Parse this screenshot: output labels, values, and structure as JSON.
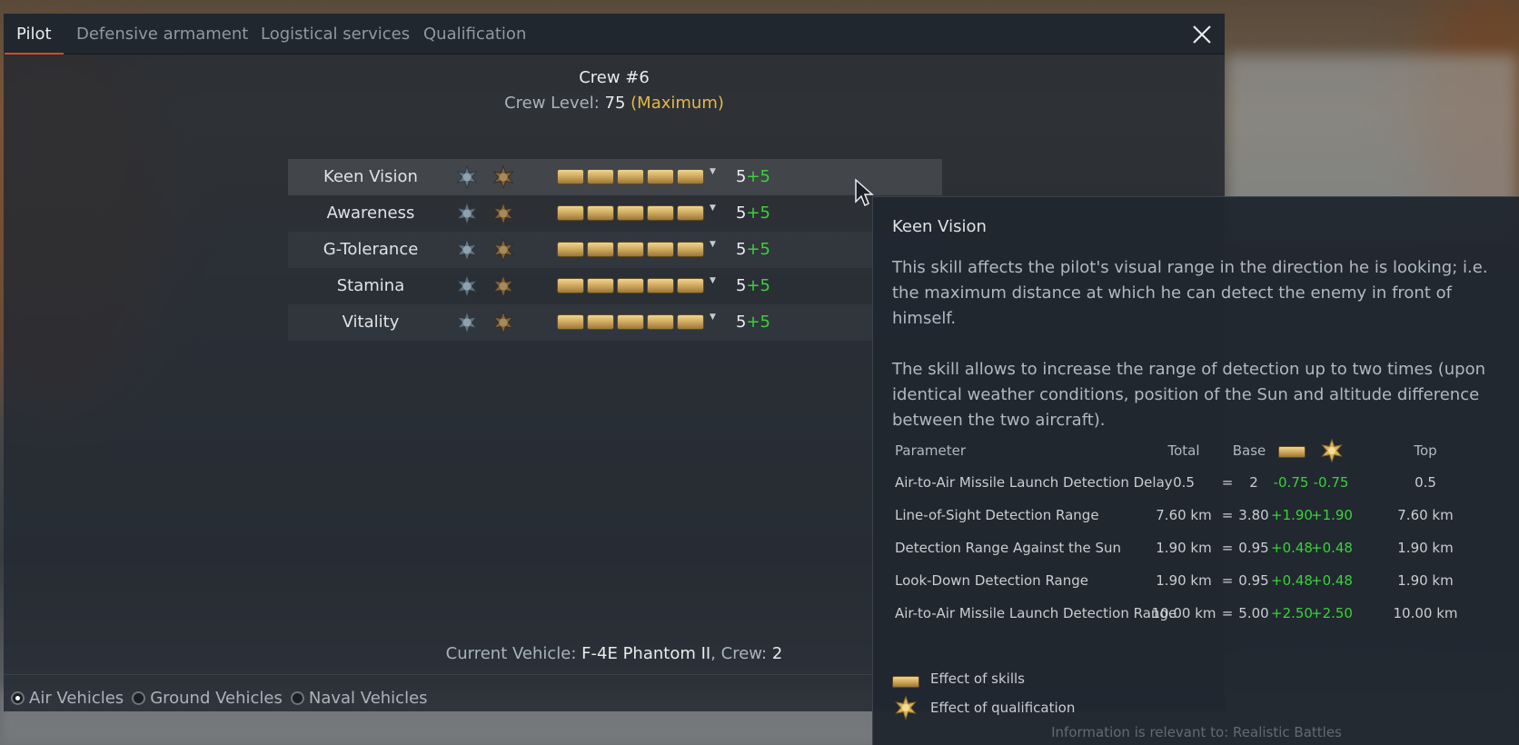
{
  "tabs": [
    {
      "label": "Pilot",
      "active": true
    },
    {
      "label": "Defensive armament",
      "active": false
    },
    {
      "label": "Logistical services",
      "active": false
    },
    {
      "label": "Qualification",
      "active": false
    }
  ],
  "crew": {
    "title": "Crew #6",
    "level_prefix": "Crew Level:",
    "level_value": "75",
    "level_note": "(Maximum)"
  },
  "skills": [
    {
      "name": "Keen Vision",
      "value": "5",
      "bonus": "+5",
      "bars_filled": 5
    },
    {
      "name": "Awareness",
      "value": "5",
      "bonus": "+5",
      "bars_filled": 5
    },
    {
      "name": "G-Tolerance",
      "value": "5",
      "bonus": "+5",
      "bars_filled": 5
    },
    {
      "name": "Stamina",
      "value": "5",
      "bonus": "+5",
      "bars_filled": 5
    },
    {
      "name": "Vitality",
      "value": "5",
      "bonus": "+5",
      "bars_filled": 5
    }
  ],
  "current_vehicle": {
    "prefix": "Current Vehicle:",
    "name": "F-4E Phantom II",
    "crew_prefix": ", Crew:",
    "crew_count": "2"
  },
  "vehicle_filters": [
    {
      "label": "Air Vehicles",
      "selected": true
    },
    {
      "label": "Ground Vehicles",
      "selected": false
    },
    {
      "label": "Naval Vehicles",
      "selected": false
    }
  ],
  "tooltip": {
    "title": "Keen Vision",
    "desc_1": "This skill affects the pilot's visual range in the direction he is looking; i.e. the maximum distance at which he can detect the enemy in front of himself.",
    "desc_2": "The skill allows to increase the range of detection up to two times (upon identical weather conditions, position of the Sun and altitude difference between the two aircraft).",
    "headers": {
      "parameter": "Parameter",
      "total": "Total",
      "base": "Base",
      "top": "Top"
    },
    "rows": [
      {
        "parameter": "Air-to-Air Missile Launch Detection Delay",
        "total": "0.5",
        "eq": "=",
        "base": "2",
        "skill": "-0.75",
        "qual": "-0.75",
        "top": "0.5"
      },
      {
        "parameter": "Line-of-Sight Detection Range",
        "total": "7.60 km",
        "eq": "=",
        "base": "3.80",
        "skill": "+1.90",
        "qual": "+1.90",
        "top": "7.60 km"
      },
      {
        "parameter": "Detection Range Against the Sun",
        "total": "1.90 km",
        "eq": "=",
        "base": "0.95",
        "skill": "+0.48",
        "qual": "+0.48",
        "top": "1.90 km"
      },
      {
        "parameter": "Look-Down Detection Range",
        "total": "1.90 km",
        "eq": "=",
        "base": "0.95",
        "skill": "+0.48",
        "qual": "+0.48",
        "top": "1.90 km"
      },
      {
        "parameter": "Air-to-Air Missile Launch Detection Range",
        "total": "10.00 km",
        "eq": "=",
        "base": "5.00",
        "skill": "+2.50",
        "qual": "+2.50",
        "top": "10.00 km"
      }
    ],
    "legend": {
      "skills": "Effect of skills",
      "qualification": "Effect of qualification"
    },
    "footer": "Information is relevant to: Realistic Battles"
  },
  "colors": {
    "accent": "#d84a1f",
    "gold": "#e3b84a",
    "bonus_green": "#3bd13b"
  },
  "icons": {
    "close": "close-icon",
    "silver_star": "silver-star-icon",
    "gold_star": "gold-star-icon",
    "cursor": "mouse-cursor-icon"
  }
}
